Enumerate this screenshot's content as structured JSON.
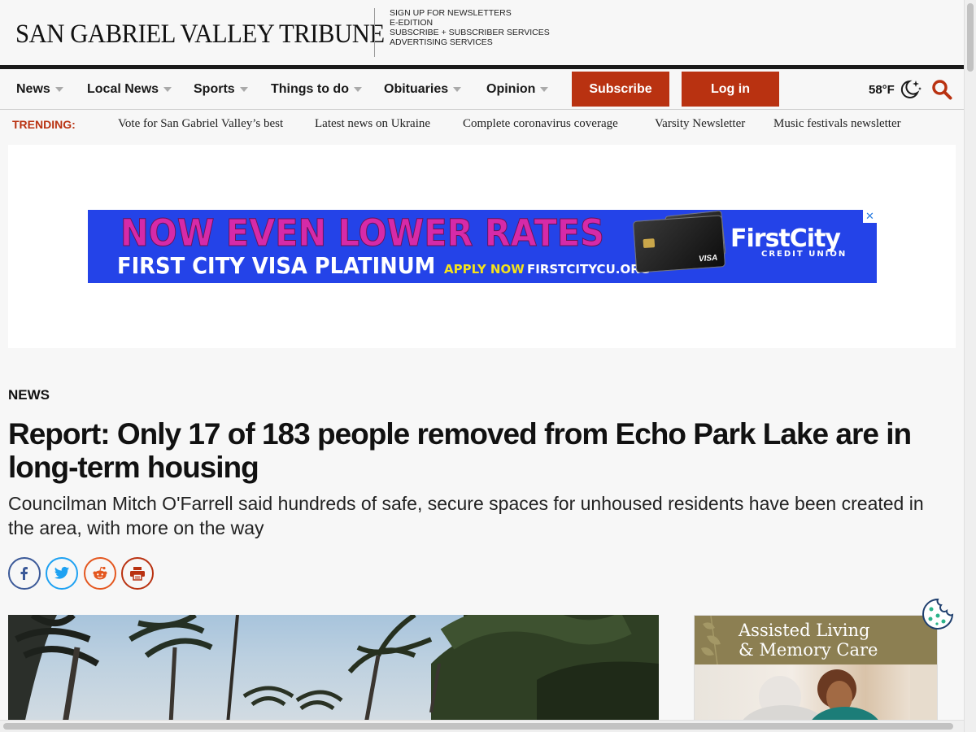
{
  "masthead": {
    "logo": "SAN GABRIEL VALLEY TRIBUNE",
    "links": [
      "SIGN UP FOR NEWSLETTERS",
      "E-EDITION",
      "SUBSCRIBE + SUBSCRIBER SERVICES",
      "ADVERTISING SERVICES"
    ]
  },
  "nav": {
    "items": [
      "News",
      "Local News",
      "Sports",
      "Things to do",
      "Obituaries",
      "Opinion"
    ],
    "subscribe": "Subscribe",
    "login": "Log in",
    "weather": "58°F",
    "weather_icon": "moon-stars-icon",
    "search_icon": "search-icon"
  },
  "trending": {
    "label": "TRENDING:",
    "links": [
      "Vote for San Gabriel Valley’s best",
      "Latest news on Ukraine",
      "Complete coronavirus coverage",
      "Varsity Newsletter",
      "Music festivals newsletter"
    ]
  },
  "ad_banner": {
    "headline": "NOW EVEN LOWER RATES",
    "subline": "FIRST CITY VISA PLATINUM",
    "apply": "APPLY NOW",
    "url": "FIRSTCITYCU.ORG",
    "card_brand": "VISA",
    "logo_name": "FirstCity",
    "logo_sub": "CREDIT UNION",
    "close": "✕",
    "colors": {
      "background": "#2443e8",
      "headline": "#d62aa8",
      "apply": "#f4e21b"
    }
  },
  "article": {
    "kicker": "NEWS",
    "headline": "Report: Only 17 of 183 people removed from Echo Park Lake are in long-term housing",
    "dek": "Councilman Mitch O'Farrell said hundreds of safe, secure spaces for unhoused residents have been created in the area, with more on the way",
    "share": [
      {
        "name": "facebook-icon",
        "color": "#3b5998"
      },
      {
        "name": "twitter-icon",
        "color": "#1da1f2"
      },
      {
        "name": "reddit-icon",
        "color": "#e4571f"
      },
      {
        "name": "print-icon",
        "color": "#b93211"
      }
    ]
  },
  "side_ad": {
    "title_line1": "Assisted Living",
    "title_line2": "& Memory Care"
  },
  "colors": {
    "accent": "#b93211",
    "text": "#111111"
  }
}
